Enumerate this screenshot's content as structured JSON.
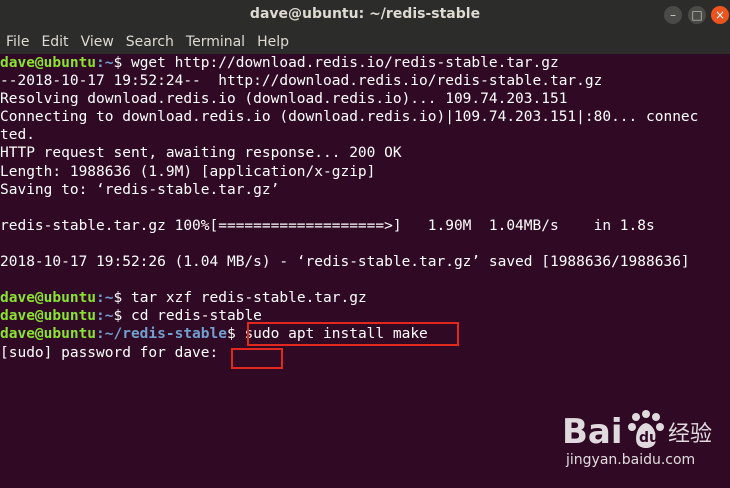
{
  "window": {
    "title": "dave@ubuntu: ~/redis-stable",
    "minimize_glyph": "–",
    "maximize_glyph": "□",
    "close_glyph": "×"
  },
  "menu": [
    "File",
    "Edit",
    "View",
    "Search",
    "Terminal",
    "Help"
  ],
  "terminal": {
    "lines": [
      {
        "user": "dave@ubuntu",
        "path": ":~",
        "prompt_end": "$ ",
        "text": "wget http://download.redis.io/redis-stable.tar.gz"
      },
      {
        "text": "--2018-10-17 19:52:24--  http://download.redis.io/redis-stable.tar.gz"
      },
      {
        "text": "Resolving download.redis.io (download.redis.io)... 109.74.203.151"
      },
      {
        "text": "Connecting to download.redis.io (download.redis.io)|109.74.203.151|:80... connec"
      },
      {
        "text": "ted."
      },
      {
        "text": "HTTP request sent, awaiting response... 200 OK"
      },
      {
        "text": "Length: 1988636 (1.9M) [application/x-gzip]"
      },
      {
        "text": "Saving to: ‘redis-stable.tar.gz’"
      },
      {
        "text": ""
      },
      {
        "text": "redis-stable.tar.gz 100%[===================>]   1.90M  1.04MB/s    in 1.8s"
      },
      {
        "text": ""
      },
      {
        "text": "2018-10-17 19:52:26 (1.04 MB/s) - ‘redis-stable.tar.gz’ saved [1988636/1988636]"
      },
      {
        "text": ""
      },
      {
        "user": "dave@ubuntu",
        "path": ":~",
        "prompt_end": "$ ",
        "text": "tar xzf redis-stable.tar.gz"
      },
      {
        "user": "dave@ubuntu",
        "path": ":~",
        "prompt_end": "$ ",
        "text": "cd redis-stable"
      },
      {
        "user": "dave@ubuntu",
        "path": ":~/redis-stable",
        "prompt_end": "$ ",
        "text": "sudo apt install make"
      },
      {
        "text": "[sudo] password for dave: "
      }
    ]
  },
  "annotations": {
    "highlight_color": "#e0281e"
  },
  "watermark": {
    "logo_text": "Bai du 经验",
    "subtitle": "jingyan.baidu.com"
  },
  "colors": {
    "background": "#300a24",
    "user": "#8ae234",
    "path": "#729fcf",
    "titlebar": "#2c2c2a"
  }
}
